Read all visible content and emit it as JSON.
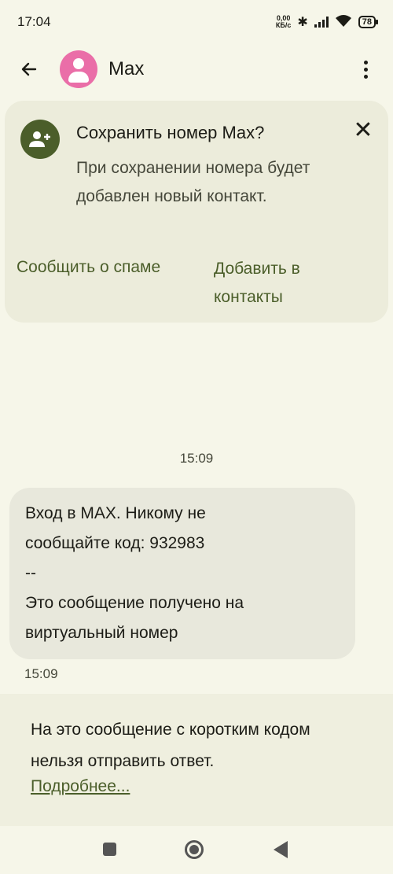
{
  "status_bar": {
    "time": "17:04",
    "net_speed_value": "0,00",
    "net_speed_unit": "КБ/с",
    "battery": "78",
    "icons": [
      "bluetooth-icon",
      "signal-icon",
      "wifi-icon",
      "battery-icon"
    ]
  },
  "app_bar": {
    "contact_name": "Max",
    "icons": [
      "back-arrow-icon",
      "avatar-icon",
      "more-vert-icon"
    ]
  },
  "save_card": {
    "title": "Сохранить номер Max?",
    "description": "При сохранении номера будет добавлен новый контакт.",
    "spam_label": "Сообщить о спаме",
    "add_label": "Добавить в контакты",
    "icons": [
      "add-person-icon",
      "close-icon"
    ]
  },
  "conversation": {
    "timestamp": "15:09",
    "message": {
      "lines": [
        "Вход в MAX. Никому не",
        "сообщайте код: 932983",
        "--",
        "Это сообщение получено на",
        "виртуальный номер"
      ],
      "time": "15:09"
    }
  },
  "notice": {
    "text": "На это сообщение с коротким кодом нельзя отправить ответ.",
    "link": "Подробнее..."
  },
  "nav_bar": {
    "icons": [
      "recents-icon",
      "home-icon",
      "back-icon"
    ]
  },
  "colors": {
    "background": "#f6f6e9",
    "accent": "#4b5e2a",
    "avatar": "#ea6ea8"
  }
}
